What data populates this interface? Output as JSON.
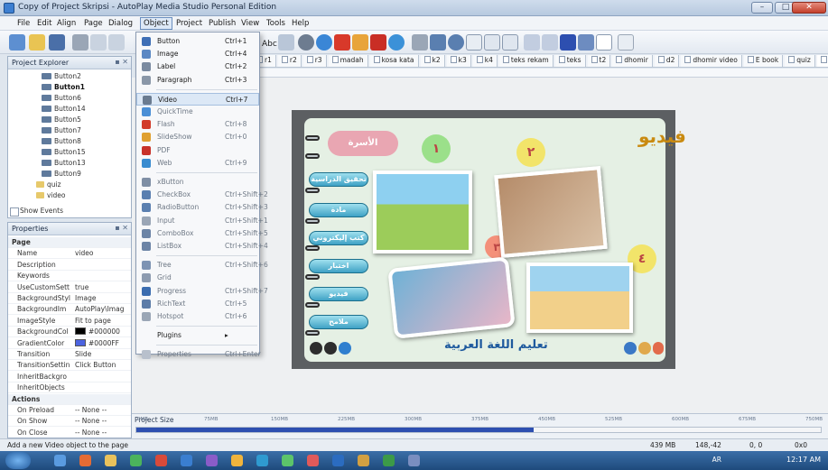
{
  "window": {
    "title": "Copy of Project Skripsi - AutoPlay Media Studio Personal Edition",
    "controls": [
      "–",
      "□",
      "✕"
    ]
  },
  "menubar": [
    "File",
    "Edit",
    "Align",
    "Page",
    "Dialog",
    "Object",
    "Project",
    "Publish",
    "View",
    "Tools",
    "Help"
  ],
  "menubar_active": "Object",
  "toolbar": {
    "text_label": "Abc"
  },
  "project_explorer": {
    "title": "Project Explorer",
    "items": [
      {
        "label": "Button2",
        "type": "button"
      },
      {
        "label": "Button1",
        "type": "button",
        "bold": true
      },
      {
        "label": "Button6",
        "type": "button"
      },
      {
        "label": "Button14",
        "type": "button"
      },
      {
        "label": "Button5",
        "type": "button"
      },
      {
        "label": "Button7",
        "type": "button"
      },
      {
        "label": "Button8",
        "type": "button"
      },
      {
        "label": "Button15",
        "type": "button"
      },
      {
        "label": "Button13",
        "type": "button"
      },
      {
        "label": "Button9",
        "type": "button"
      },
      {
        "label": "quiz",
        "type": "folder"
      },
      {
        "label": "video",
        "type": "folder"
      }
    ],
    "show_events": "Show Events"
  },
  "properties": {
    "title": "Properties",
    "rows": [
      {
        "name": "Page",
        "value": "",
        "group": true
      },
      {
        "name": "Name",
        "value": "video"
      },
      {
        "name": "Description",
        "value": ""
      },
      {
        "name": "Keywords",
        "value": ""
      },
      {
        "name": "UseCustomSett",
        "value": "true"
      },
      {
        "name": "BackgroundStyl",
        "value": "Image"
      },
      {
        "name": "BackgroundIm",
        "value": "AutoPlay\\Imag"
      },
      {
        "name": "ImageStyle",
        "value": "Fit to page"
      },
      {
        "name": "BackgroundCol",
        "value": "#000000",
        "swatch": "#000000"
      },
      {
        "name": "GradientColor",
        "value": "#0000FF",
        "swatch": "#4b63e0"
      },
      {
        "name": "Transition",
        "value": "Slide"
      },
      {
        "name": "TransitionSettin",
        "value": "Click Button"
      },
      {
        "name": "InheritBackgro",
        "value": ""
      },
      {
        "name": "InheritObjects",
        "value": ""
      },
      {
        "name": "Actions",
        "value": "",
        "group": true
      },
      {
        "name": "On Preload",
        "value": "-- None --"
      },
      {
        "name": "On Show",
        "value": "-- None --"
      },
      {
        "name": "On Close",
        "value": "-- None --"
      }
    ]
  },
  "page_tabs": [
    {
      "label": "r1"
    },
    {
      "label": "r2"
    },
    {
      "label": "r3"
    },
    {
      "label": "madah"
    },
    {
      "label": "kosa kata"
    },
    {
      "label": "k2"
    },
    {
      "label": "k3"
    },
    {
      "label": "k4"
    },
    {
      "label": "teks rekam"
    },
    {
      "label": "teks"
    },
    {
      "label": "t2"
    },
    {
      "label": "dhomir"
    },
    {
      "label": "d2"
    },
    {
      "label": "dhomir video"
    },
    {
      "label": "E book"
    },
    {
      "label": "quiz"
    },
    {
      "label": "video",
      "active": true
    }
  ],
  "object_menu": [
    {
      "label": "Button",
      "shortcut": "Ctrl+1",
      "icon_color": "#3f6fb6"
    },
    {
      "label": "Image",
      "shortcut": "Ctrl+4",
      "icon_color": "#5b88c4"
    },
    {
      "label": "Label",
      "shortcut": "Ctrl+2",
      "icon_color": "#7a8aa0"
    },
    {
      "label": "Paragraph",
      "shortcut": "Ctrl+3",
      "icon_color": "#8a97a8"
    },
    {
      "sep": true
    },
    {
      "label": "Video",
      "shortcut": "Ctrl+7",
      "icon_color": "#6a7b90",
      "highlight": true
    },
    {
      "label": "QuickTime",
      "shortcut": "",
      "icon_color": "#4b8fd6",
      "dim": true
    },
    {
      "label": "Flash",
      "shortcut": "Ctrl+8",
      "icon_color": "#d23b2a",
      "dim": true
    },
    {
      "label": "SlideShow",
      "shortcut": "Ctrl+0",
      "icon_color": "#e0a030",
      "dim": true
    },
    {
      "label": "PDF",
      "shortcut": "",
      "icon_color": "#c8322a",
      "dim": true
    },
    {
      "label": "Web",
      "shortcut": "Ctrl+9",
      "icon_color": "#3a8cd0",
      "dim": true
    },
    {
      "sep": true
    },
    {
      "label": "xButton",
      "shortcut": "",
      "icon_color": "#7f8fa5",
      "dim": true
    },
    {
      "label": "CheckBox",
      "shortcut": "Ctrl+Shift+2",
      "icon_color": "#5a7fb0",
      "dim": true
    },
    {
      "label": "RadioButton",
      "shortcut": "Ctrl+Shift+3",
      "icon_color": "#5a7fb0",
      "dim": true
    },
    {
      "label": "Input",
      "shortcut": "Ctrl+Shift+1",
      "icon_color": "#9aa6b6",
      "dim": true
    },
    {
      "label": "ComboBox",
      "shortcut": "Ctrl+Shift+5",
      "icon_color": "#6c84a6",
      "dim": true
    },
    {
      "label": "ListBox",
      "shortcut": "Ctrl+Shift+4",
      "icon_color": "#6c84a6",
      "dim": true
    },
    {
      "sep": true
    },
    {
      "label": "Tree",
      "shortcut": "Ctrl+Shift+6",
      "icon_color": "#7d93b3",
      "dim": true
    },
    {
      "label": "Grid",
      "shortcut": "",
      "icon_color": "#8d9bb0",
      "dim": true
    },
    {
      "label": "Progress",
      "shortcut": "Ctrl+Shift+7",
      "icon_color": "#3c6db0",
      "dim": true
    },
    {
      "label": "RichText",
      "shortcut": "Ctrl+5",
      "icon_color": "#5c7ca8",
      "dim": true
    },
    {
      "label": "Hotspot",
      "shortcut": "Ctrl+6",
      "icon_color": "#9aa6b6",
      "dim": true
    },
    {
      "sep": true
    },
    {
      "label": "Plugins",
      "shortcut": "▸",
      "icon_color": "transparent"
    },
    {
      "sep": true
    },
    {
      "label": "Properties",
      "shortcut": "Ctrl+Enter",
      "icon_color": "#b8c0cc",
      "dim": true
    }
  ],
  "stage": {
    "title_ar": "فيديو",
    "bottom_title_ar": "تعليم اللغة العربية",
    "top_pill_ar": "الأسرة",
    "nav_buttons_ar": [
      "تحقيق الدراسية",
      "مادة",
      "كتب إليكتروني",
      "اختبار",
      "فيديو",
      "ملامح"
    ],
    "numbers": [
      "١",
      "٢",
      "٣",
      "٤"
    ]
  },
  "project_size": {
    "label": "Project Size",
    "fill_fraction": 0.58,
    "ticks": [
      "0MB",
      "75MB",
      "150MB",
      "225MB",
      "300MB",
      "375MB",
      "450MB",
      "525MB",
      "600MB",
      "675MB",
      "750MB"
    ]
  },
  "statusbar": {
    "hint": "Add a new Video object to the page",
    "memory": "439 MB",
    "coords": "148,-42",
    "size": "0, 0",
    "extra": "0x0"
  },
  "taskbar": {
    "lang": "AR",
    "time": "12:17 AM"
  }
}
